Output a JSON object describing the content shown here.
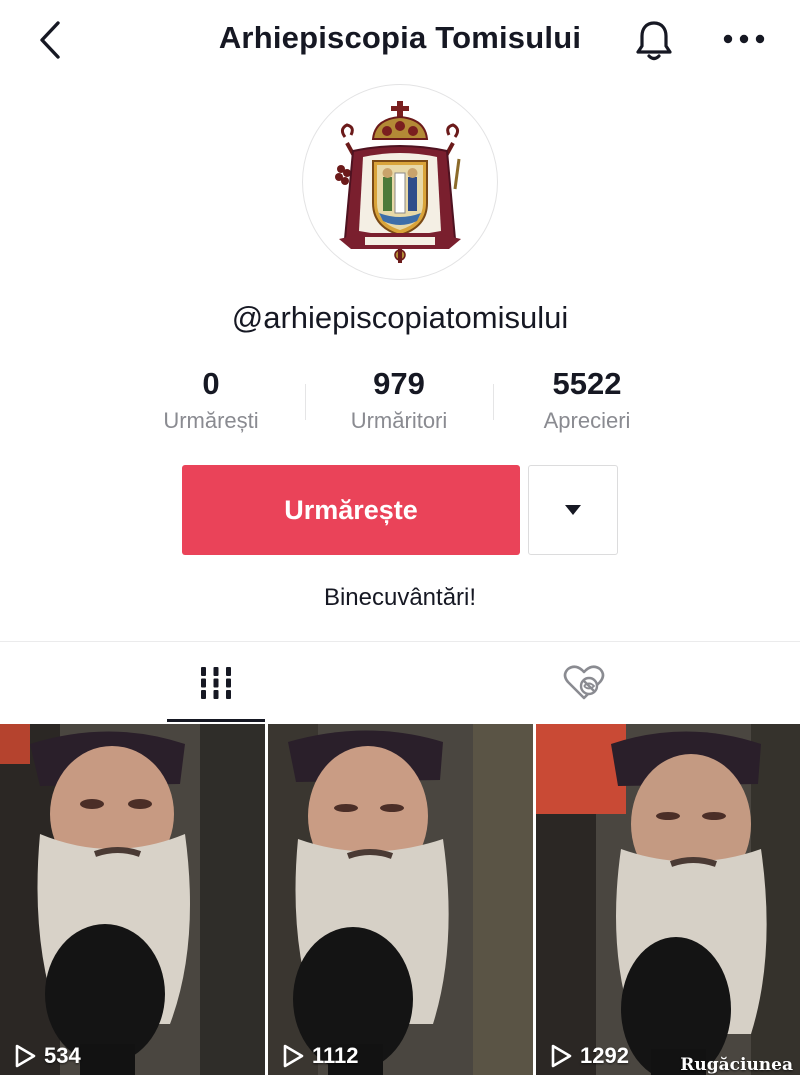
{
  "header": {
    "title": "Arhiepiscopia Tomisului",
    "back_icon": "chevron-left-icon",
    "bell_icon": "bell-icon",
    "more_icon": "more-dots-icon"
  },
  "profile": {
    "avatar_icon": "archdiocese-coat-of-arms-logo",
    "username": "@arhiepiscopiatomisului",
    "bio": "Binecuvântări!"
  },
  "stats": [
    {
      "value": "0",
      "label": "Urmărești"
    },
    {
      "value": "979",
      "label": "Urmăritori"
    },
    {
      "value": "5522",
      "label": "Aprecieri"
    }
  ],
  "actions": {
    "follow_label": "Urmărește",
    "follow_color": "#ea4359",
    "dropdown_icon": "caret-down-icon"
  },
  "tabs": [
    {
      "name": "videos",
      "icon": "grid-icon",
      "active": true
    },
    {
      "name": "liked",
      "icon": "heart-hidden-icon",
      "active": false
    }
  ],
  "videos": [
    {
      "views": "534",
      "caption": ""
    },
    {
      "views": "1112",
      "caption": ""
    },
    {
      "views": "1292",
      "caption": "Rugăciunea"
    }
  ]
}
